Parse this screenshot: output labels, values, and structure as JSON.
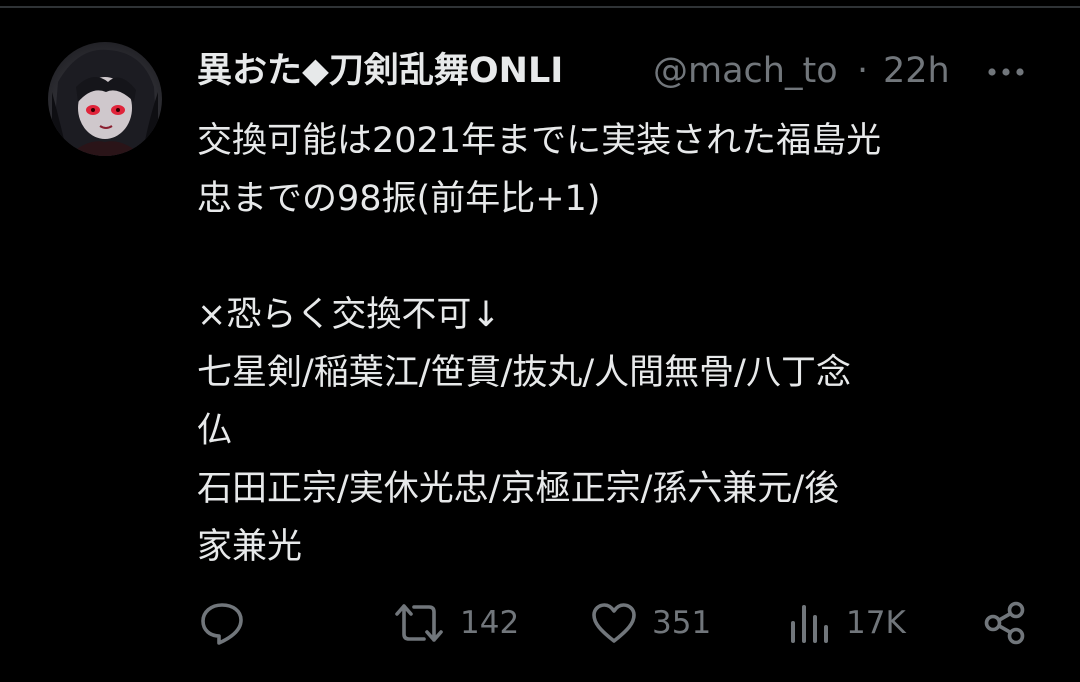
{
  "author": {
    "display_name": "異おた◆刀剣乱舞ONLI",
    "handle": "@mach_to",
    "separator": "·",
    "time": "22h"
  },
  "tweet": {
    "lines": [
      "交換可能は2021年までに実装された福島光",
      "忠までの98振(前年比+1)",
      "",
      "×恐らく交換不可↓",
      "七星剣/稲葉江/笹貫/抜丸/人間無骨/八丁念",
      "仏",
      "石田正宗/実休光忠/京極正宗/孫六兼元/後",
      "家兼光"
    ]
  },
  "actions": {
    "reply_icon": "reply-icon",
    "retweet_icon": "retweet-icon",
    "retweet_count": "142",
    "like_icon": "heart-icon",
    "like_count": "351",
    "views_icon": "views-icon",
    "views_count": "17K",
    "share_icon": "share-icon"
  },
  "colors": {
    "background": "#000000",
    "text": "#e7e9ea",
    "secondary": "#71767b",
    "divider": "#2f3336"
  }
}
